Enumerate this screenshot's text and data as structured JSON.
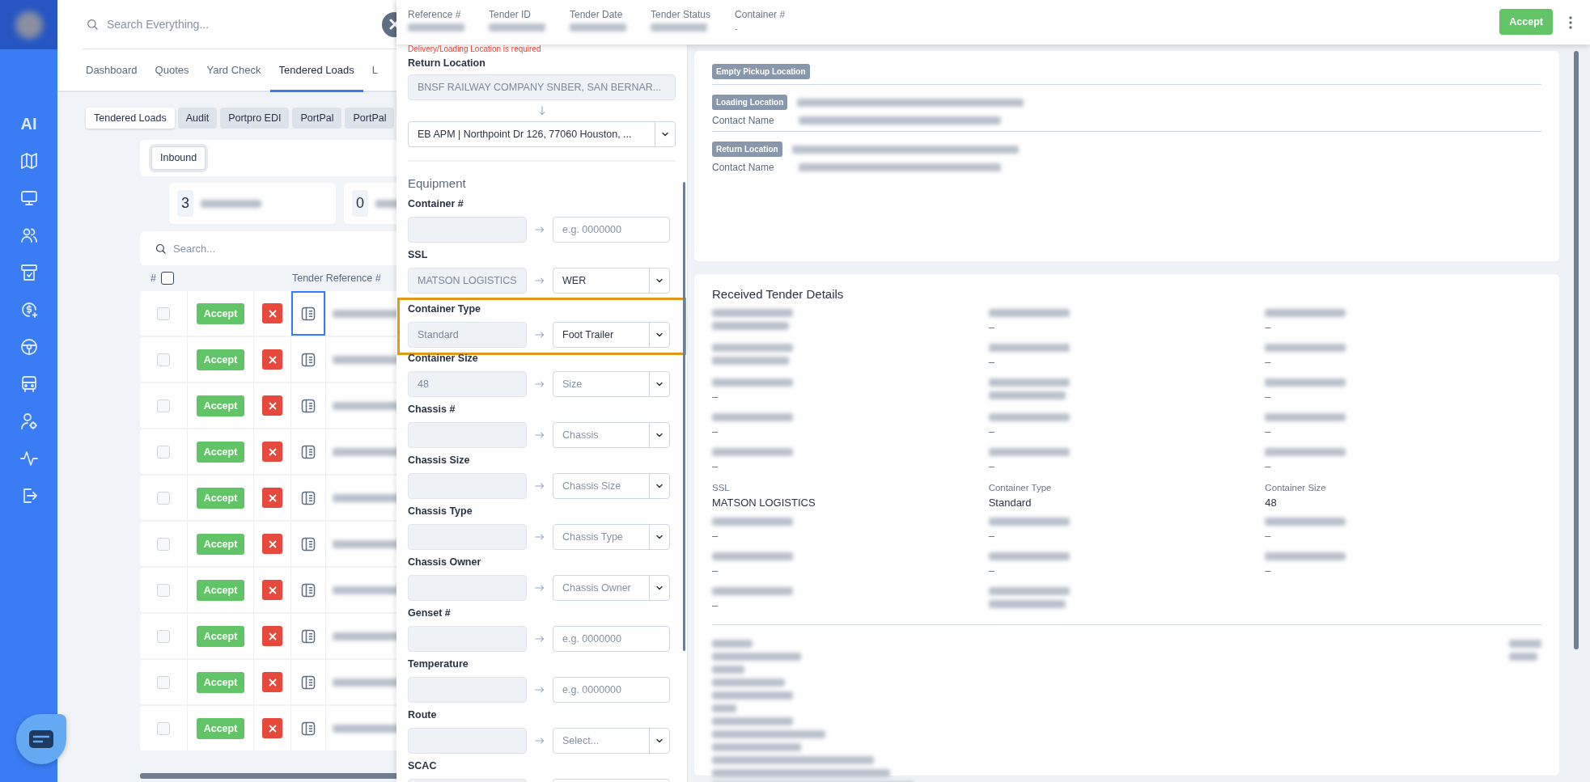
{
  "sidebar": {
    "items": [
      {
        "kind": "text",
        "label": "AI"
      },
      {
        "kind": "map"
      },
      {
        "kind": "monitor"
      },
      {
        "kind": "users"
      },
      {
        "kind": "receipt"
      },
      {
        "kind": "dollar"
      },
      {
        "kind": "steering"
      },
      {
        "kind": "bus"
      },
      {
        "kind": "user-gear"
      },
      {
        "kind": "activity"
      },
      {
        "kind": "logout"
      }
    ]
  },
  "search": {
    "placeholder": "Search Everything..."
  },
  "nav_tabs": [
    {
      "label": "Dashboard",
      "selected": false
    },
    {
      "label": "Quotes",
      "selected": false
    },
    {
      "label": "Yard Check",
      "selected": false
    },
    {
      "label": "Tendered Loads",
      "selected": true
    },
    {
      "label": "L",
      "selected": false
    }
  ],
  "sub_tabs": [
    {
      "label": "Tendered Loads",
      "selected": true
    },
    {
      "label": "Audit",
      "selected": false
    },
    {
      "label": "Portpro EDI",
      "selected": false
    },
    {
      "label": "PortPal",
      "selected": false
    },
    {
      "label": "PortPal",
      "selected": false
    }
  ],
  "filters": [
    {
      "label": "Inbound",
      "selected": true
    }
  ],
  "stats": [
    {
      "count": "3"
    },
    {
      "count": "0"
    }
  ],
  "table": {
    "search_placeholder": "Search...",
    "columns": [
      "#",
      "Tender Reference #"
    ],
    "header_checked": false,
    "rows": [
      {
        "checked": false,
        "selected": true,
        "action": "Accept"
      },
      {
        "checked": false,
        "selected": false,
        "action": "Accept"
      },
      {
        "checked": false,
        "selected": false,
        "action": "Accept"
      },
      {
        "checked": false,
        "selected": false,
        "action": "Accept"
      },
      {
        "checked": false,
        "selected": false,
        "action": "Accept"
      },
      {
        "checked": false,
        "selected": false,
        "action": "Accept"
      },
      {
        "checked": false,
        "selected": false,
        "action": "Accept"
      },
      {
        "checked": false,
        "selected": false,
        "action": "Accept"
      },
      {
        "checked": false,
        "selected": false,
        "action": "Accept"
      },
      {
        "checked": false,
        "selected": false,
        "action": "Accept"
      }
    ]
  },
  "drawer": {
    "header": [
      {
        "label": "Reference #"
      },
      {
        "label": "Tender ID"
      },
      {
        "label": "Tender Date"
      },
      {
        "label": "Tender Status"
      },
      {
        "label": "Container #",
        "value": "-"
      }
    ],
    "accept": "Accept",
    "form": {
      "error": "Delivery/Loading Location is required",
      "return_location": {
        "label": "Return Location",
        "from": "BNSF RAILWAY COMPANY SNBER, SAN BERNAR...",
        "to": "EB APM | Northpoint Dr 126, 77060 Houston, ..."
      },
      "section": "Equipment",
      "fields": [
        {
          "label": "Container #",
          "highlighted": false,
          "target": {
            "kind": "input",
            "placeholder": "e.g. 0000000"
          }
        },
        {
          "label": "SSL",
          "source": "MATSON LOGISTICS",
          "highlighted": false,
          "target": {
            "kind": "select",
            "value": "WER"
          }
        },
        {
          "label": "Container Type",
          "source": "Standard",
          "highlighted": true,
          "target": {
            "kind": "select",
            "value": "Foot Trailer"
          }
        },
        {
          "label": "Container Size",
          "source": "48",
          "highlighted": false,
          "target": {
            "kind": "select",
            "placeholder": "Size"
          }
        },
        {
          "label": "Chassis #",
          "highlighted": false,
          "target": {
            "kind": "select",
            "placeholder": "Chassis"
          }
        },
        {
          "label": "Chassis Size",
          "highlighted": false,
          "target": {
            "kind": "select",
            "placeholder": "Chassis Size"
          }
        },
        {
          "label": "Chassis Type",
          "highlighted": false,
          "target": {
            "kind": "select",
            "placeholder": "Chassis Type"
          }
        },
        {
          "label": "Chassis Owner",
          "highlighted": false,
          "target": {
            "kind": "select",
            "placeholder": "Chassis Owner"
          }
        },
        {
          "label": "Genset #",
          "highlighted": false,
          "target": {
            "kind": "input",
            "placeholder": "e.g. 0000000"
          }
        },
        {
          "label": "Temperature",
          "highlighted": false,
          "target": {
            "kind": "input",
            "placeholder": "e.g. 0000000"
          }
        },
        {
          "label": "Route",
          "highlighted": false,
          "target": {
            "kind": "select",
            "placeholder": "Select..."
          }
        },
        {
          "label": "SCAC",
          "highlighted": false,
          "target": {
            "kind": "input"
          }
        }
      ]
    },
    "locations": [
      {
        "tag": "Empty Pickup Location",
        "kind": "empty"
      },
      {
        "tag": "Loading Location",
        "kind": "detailed",
        "contact_label": "Contact Name"
      },
      {
        "tag": "Return Location",
        "kind": "detailed",
        "contact_label": "Contact Name"
      }
    ],
    "details": {
      "title": "Received Tender Details",
      "items": [
        {
          "kind": "redacted"
        },
        {
          "kind": "redacted",
          "value": "–"
        },
        {
          "kind": "redacted",
          "value": "–"
        },
        {
          "kind": "redacted"
        },
        {
          "kind": "redacted",
          "value": "–"
        },
        {
          "kind": "redacted",
          "value": "–"
        },
        {
          "kind": "redacted",
          "value": "–"
        },
        {
          "kind": "redacted"
        },
        {
          "kind": "redacted",
          "value": "–"
        },
        {
          "kind": "redacted",
          "value": "–"
        },
        {
          "kind": "redacted",
          "value": "–"
        },
        {
          "kind": "redacted",
          "value": "–"
        },
        {
          "kind": "redacted",
          "value": "–"
        },
        {
          "kind": "redacted",
          "value": "–"
        },
        {
          "kind": "redacted",
          "value": "–"
        },
        {
          "kind": "plain",
          "label": "SSL",
          "value": "MATSON LOGISTICS"
        },
        {
          "kind": "plain",
          "label": "Container Type",
          "value": "Standard"
        },
        {
          "kind": "plain",
          "label": "Container Size",
          "value": "48"
        },
        {
          "kind": "redacted",
          "value": "–"
        },
        {
          "kind": "redacted",
          "value": "–"
        },
        {
          "kind": "redacted",
          "value": "–"
        },
        {
          "kind": "redacted",
          "value": "–"
        },
        {
          "kind": "redacted",
          "value": "–"
        },
        {
          "kind": "redacted",
          "value": "–"
        },
        {
          "kind": "redacted",
          "value": "–"
        },
        {
          "kind": "redacted"
        }
      ],
      "notes": {
        "kind": "redacted"
      }
    }
  }
}
